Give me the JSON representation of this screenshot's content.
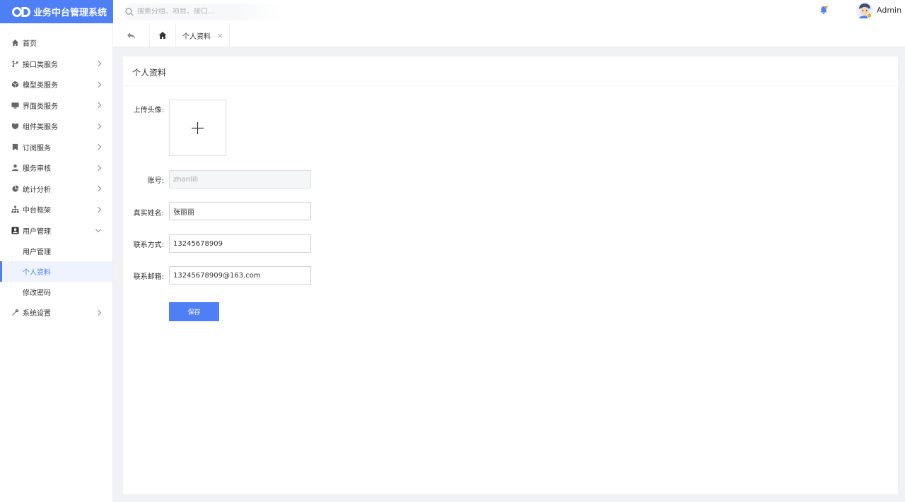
{
  "app": {
    "title": "业务中台管理系统",
    "logo": "od-logo-icon"
  },
  "header": {
    "search_placeholder": "搜索分组、项目、接口...",
    "username": "Admin"
  },
  "colors": {
    "accent": "#4f7ff5",
    "badge": "#f5a623"
  },
  "sidebar": {
    "items": [
      {
        "label": "首页",
        "icon": "home-icon"
      },
      {
        "label": "接口类服务",
        "icon": "branch-icon"
      },
      {
        "label": "模型类服务",
        "icon": "cube-icon"
      },
      {
        "label": "界面类服务",
        "icon": "monitor-icon"
      },
      {
        "label": "组件类服务",
        "icon": "puzzle-icon"
      },
      {
        "label": "订阅服务",
        "icon": "bookmark-icon"
      },
      {
        "label": "服务审核",
        "icon": "user-icon"
      },
      {
        "label": "统计分析",
        "icon": "pie-chart-icon"
      },
      {
        "label": "中台框架",
        "icon": "org-chart-icon"
      },
      {
        "label": "用户管理",
        "icon": "user-card-icon"
      },
      {
        "label": "系统设置",
        "icon": "wrench-icon"
      }
    ],
    "sub_items": [
      {
        "label": "用户管理"
      },
      {
        "label": "个人资料"
      },
      {
        "label": "修改密码"
      }
    ]
  },
  "tabs": {
    "active_label": "个人资料",
    "close": "×"
  },
  "page": {
    "title": "个人资料",
    "avatar_label": "上传头像:",
    "account_label": "账号:",
    "account_value": "zhanlili",
    "name_label": "真实姓名:",
    "name_value": "张丽丽",
    "phone_label": "联系方式:",
    "phone_value": "13245678909",
    "email_label": "联系邮箱:",
    "email_value": "13245678909@163.com",
    "save_label": "保存"
  }
}
